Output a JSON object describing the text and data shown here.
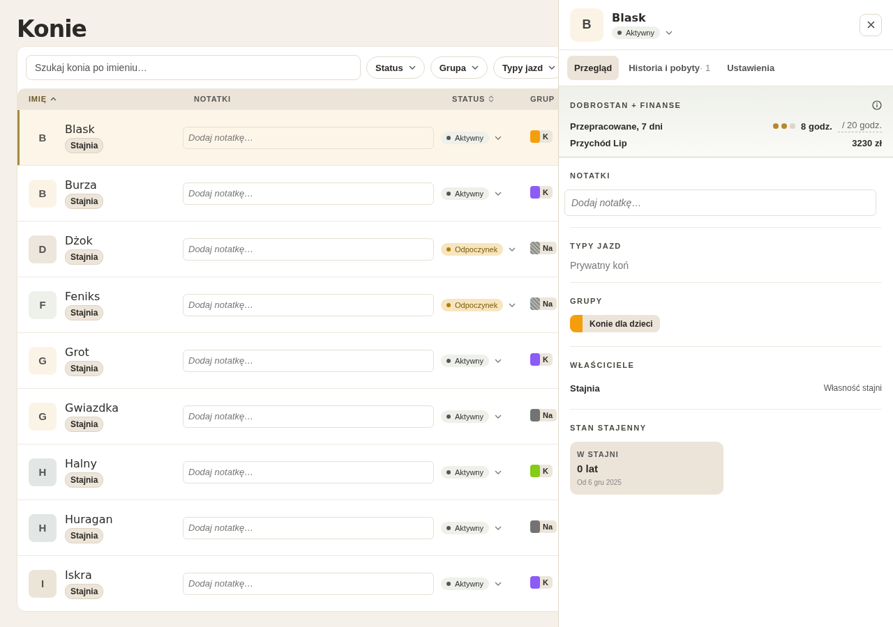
{
  "page": {
    "title": "Konie"
  },
  "filters": {
    "search_placeholder": "Szukaj konia po imieniu…",
    "buttons": [
      "Status",
      "Grupa",
      "Typy jazd"
    ]
  },
  "table": {
    "columns": [
      {
        "label": "IMIĘ",
        "sorted_asc": true,
        "sortable": true
      },
      {
        "label": "NOTATKI",
        "sorted_asc": false,
        "sortable": false
      },
      {
        "label": "STATUS",
        "sorted_asc": false,
        "sortable": true
      },
      {
        "label": "GRUP",
        "sorted_asc": false,
        "sortable": false
      }
    ],
    "rows": [
      {
        "avatar": {
          "initial": "B"
        },
        "name": "Blask",
        "owner": "Stajnia",
        "note_placeholder": "Dodaj notatkę…",
        "status": {
          "label": "Aktywny",
          "kind": "active"
        },
        "group": {
          "label": "K",
          "color": "#f59e0b",
          "patterned": false
        },
        "selected": true
      },
      {
        "avatar": {
          "initial": "B",
          "color": "#fbf4e6"
        },
        "name": "Burza",
        "owner": "Stajnia",
        "note_placeholder": "Dodaj notatkę…",
        "status": {
          "label": "Aktywny",
          "kind": "active"
        },
        "group": {
          "label": "K",
          "color": "#8b5cf6",
          "patterned": false
        },
        "selected": false
      },
      {
        "avatar": {
          "initial": "D",
          "color": "#ece6dc"
        },
        "name": "Dżok",
        "owner": "Stajnia",
        "note_placeholder": "Dodaj notatkę…",
        "status": {
          "label": "Odpoczynek",
          "kind": "rest"
        },
        "group": {
          "label": "Na",
          "color": "#8a8a86",
          "patterned": true
        },
        "selected": false
      },
      {
        "avatar": {
          "initial": "F",
          "color": "#eef0ea"
        },
        "name": "Feniks",
        "owner": "Stajnia",
        "note_placeholder": "Dodaj notatkę…",
        "status": {
          "label": "Odpoczynek",
          "kind": "rest"
        },
        "group": {
          "label": "Na",
          "color": "#8a8a86",
          "patterned": true
        },
        "selected": false
      },
      {
        "avatar": {
          "initial": "G",
          "color": "#fbf4e6"
        },
        "name": "Grot",
        "owner": "Stajnia",
        "note_placeholder": "Dodaj notatkę…",
        "status": {
          "label": "Aktywny",
          "kind": "active"
        },
        "group": {
          "label": "K",
          "color": "#8b5cf6",
          "patterned": false
        },
        "selected": false
      },
      {
        "avatar": {
          "initial": "G",
          "color": "#fbf4e6"
        },
        "name": "Gwiazdka",
        "owner": "Stajnia",
        "note_placeholder": "Dodaj notatkę…",
        "status": {
          "label": "Aktywny",
          "kind": "active"
        },
        "group": {
          "label": "Na",
          "color": "#737373",
          "patterned": false
        },
        "selected": false
      },
      {
        "avatar": {
          "initial": "H",
          "color": "#e2e6e4"
        },
        "name": "Halny",
        "owner": "Stajnia",
        "note_placeholder": "Dodaj notatkę…",
        "status": {
          "label": "Aktywny",
          "kind": "active"
        },
        "group": {
          "label": "K",
          "color": "#84cc16",
          "patterned": false
        },
        "selected": false
      },
      {
        "avatar": {
          "initial": "H",
          "color": "#e2e6e4"
        },
        "name": "Huragan",
        "owner": "Stajnia",
        "note_placeholder": "Dodaj notatkę…",
        "status": {
          "label": "Aktywny",
          "kind": "active"
        },
        "group": {
          "label": "Na",
          "color": "#737373",
          "patterned": false
        },
        "selected": false
      },
      {
        "avatar": {
          "initial": "I",
          "color": "#ede4d8"
        },
        "name": "Iskra",
        "owner": "Stajnia",
        "note_placeholder": "Dodaj notatkę…",
        "status": {
          "label": "Aktywny",
          "kind": "active"
        },
        "group": {
          "label": "K",
          "color": "#8b5cf6",
          "patterned": false
        },
        "selected": false
      }
    ]
  },
  "panel": {
    "initial": "B",
    "name": "Blask",
    "status": {
      "label": "Aktywny",
      "kind": "active"
    },
    "tabs": [
      {
        "label": "Przegląd",
        "selected": true
      },
      {
        "label": "Historia i pobyty",
        "count": "· 1",
        "selected": false
      },
      {
        "label": "Ustawienia",
        "selected": false
      }
    ],
    "wellness": {
      "title": "DOBROSTAN + FINANSE",
      "worked_label": "Przepracowane, 7 dni",
      "stars": 2,
      "worked_value": "8 godz.",
      "worked_limit": "/ 20 godz.",
      "income_label": "Przychód Lip",
      "income_value": "3230 zł"
    },
    "notes": {
      "title": "NOTATKI",
      "placeholder": "Dodaj notatkę…"
    },
    "ride_types": {
      "title": "TYPY JAZD",
      "value": "Prywatny koń"
    },
    "groups": {
      "title": "GRUPY",
      "items": [
        {
          "label": "Konie dla dzieci",
          "color": "#f59e0b"
        }
      ]
    },
    "owners": {
      "title": "WŁAŚCICIELE",
      "items": [
        {
          "name": "Stajnia",
          "role": "Własność stajni"
        }
      ]
    },
    "stable": {
      "title": "STAN STAJENNY",
      "card_label": "W STAJNI",
      "card_value": "0 lat",
      "card_since": "Od 6 gru 2025"
    }
  }
}
